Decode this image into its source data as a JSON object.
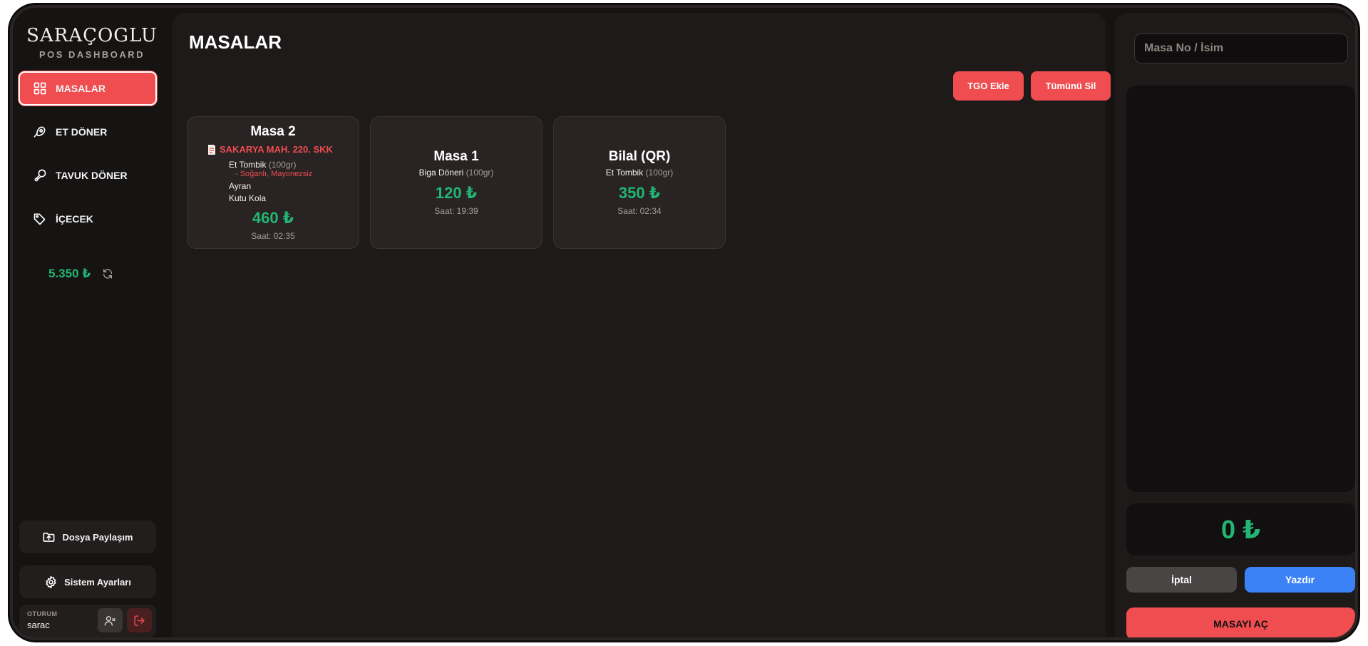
{
  "brand": {
    "title": "SARAÇOGLU",
    "subtitle": "POS DASHBOARD"
  },
  "nav": [
    {
      "label": "MASALAR",
      "icon": "grid-icon",
      "active": true
    },
    {
      "label": "ET DÖNER",
      "icon": "meat-icon",
      "active": false
    },
    {
      "label": "TAVUK DÖNER",
      "icon": "drumstick-icon",
      "active": false
    },
    {
      "label": "İÇECEK",
      "icon": "tag-icon",
      "active": false
    }
  ],
  "daily_total": "5.350 ₺",
  "sidebar_buttons": {
    "file_share": "Dosya Paylaşım",
    "settings": "Sistem Ayarları"
  },
  "session": {
    "label": "OTURUM",
    "user": "sarac"
  },
  "main": {
    "title": "MASALAR",
    "add_tgo": "TGO Ekle",
    "delete_all": "Tümünü Sil",
    "tables": [
      {
        "name": "Masa 2",
        "address": "SAKARYA MAH. 220. SKK",
        "items": [
          {
            "name": "Et Tombik",
            "portion": "(100gr)",
            "note": "- Soğanlı, Mayonezsiz"
          },
          {
            "name": "Ayran",
            "portion": "",
            "note": ""
          },
          {
            "name": "Kutu Kola",
            "portion": "",
            "note": ""
          }
        ],
        "price": "460 ₺",
        "time": "Saat: 02:35"
      },
      {
        "name": "Masa 1",
        "address": "",
        "items": [
          {
            "name": "Biga Döneri",
            "portion": "(100gr)",
            "note": ""
          }
        ],
        "price": "120 ₺",
        "time": "Saat: 19:39"
      },
      {
        "name": "Bilal (QR)",
        "address": "",
        "items": [
          {
            "name": "Et Tombik",
            "portion": "(100gr)",
            "note": ""
          }
        ],
        "price": "350 ₺",
        "time": "Saat: 02:34"
      }
    ]
  },
  "panel": {
    "search_placeholder": "Masa No / İsim",
    "total": "0 ₺",
    "cancel": "İptal",
    "print": "Yazdır",
    "open_table": "MASAYI AÇ"
  },
  "colors": {
    "accent": "#ef4d4f",
    "money": "#22b573",
    "print": "#3b82f6",
    "cancel": "#4a4545"
  }
}
